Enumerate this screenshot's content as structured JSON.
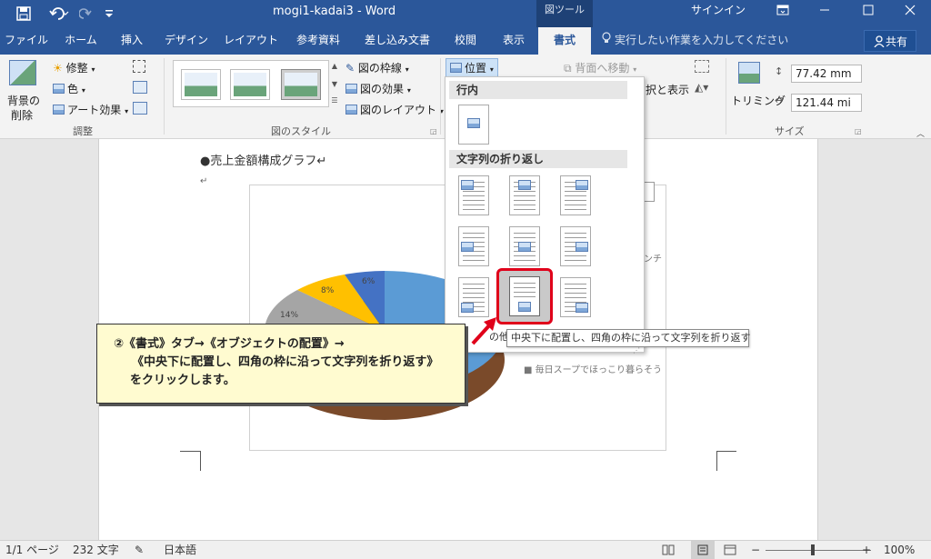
{
  "window": {
    "title": "mogi1-kadai3 - Word",
    "context_tab_group": "図ツール",
    "signin": "サインイン"
  },
  "tabs": [
    "ファイル",
    "ホーム",
    "挿入",
    "デザイン",
    "レイアウト",
    "参考資料",
    "差し込み文書",
    "校閲",
    "表示",
    "書式"
  ],
  "active_tab": "書式",
  "tell_me": "実行したい作業を入力してください",
  "share": "共有",
  "ribbon": {
    "adjust": {
      "remove_bg_line1": "背景の",
      "remove_bg_line2": "削除",
      "corrections": "修整",
      "color": "色",
      "artistic": "アート効果",
      "label": "調整"
    },
    "styles": {
      "border": "図の枠線",
      "effects": "図の効果",
      "layout": "図のレイアウト",
      "label": "図のスタイル"
    },
    "arrange": {
      "position": "位置",
      "send_backward": "背面へ移動",
      "select_pane": "択と表示"
    },
    "size": {
      "crop": "トリミング",
      "height": "77.42 mm",
      "width": "121.44 mi",
      "label": "サイズ"
    }
  },
  "document": {
    "heading": "●売上金額構成グラフ↵",
    "return_mark": "↵",
    "pie_labels": [
      "14%",
      "8%",
      "6%"
    ],
    "legend_partial_1": "ンチ",
    "legend_partial_2": "■ 毎日スープでほっこり暮らそう"
  },
  "position_menu": {
    "inline_header": "行内",
    "wrap_header": "文字列の折り返し",
    "more_options": "の他の",
    "tooltip": "中央下に配置し、四角の枠に沿って文字列を折り返す"
  },
  "callout": {
    "line1": "②《書式》タブ→《オブジェクトの配置》→",
    "line2": "《中央下に配置し、四角の枠に沿って文字列を折り返す》",
    "line3": "をクリックします。"
  },
  "statusbar": {
    "page": "1/1 ページ",
    "words": "232 文字",
    "language": "日本語",
    "zoom": "100%"
  },
  "colors": {
    "title_bar": "#2b579a",
    "highlight": "#e0001a",
    "callout_bg": "#fffbd0",
    "pie": [
      "#5b9bd5",
      "#ed7d31",
      "#a5a5a5",
      "#ffc000",
      "#4472c4"
    ]
  }
}
